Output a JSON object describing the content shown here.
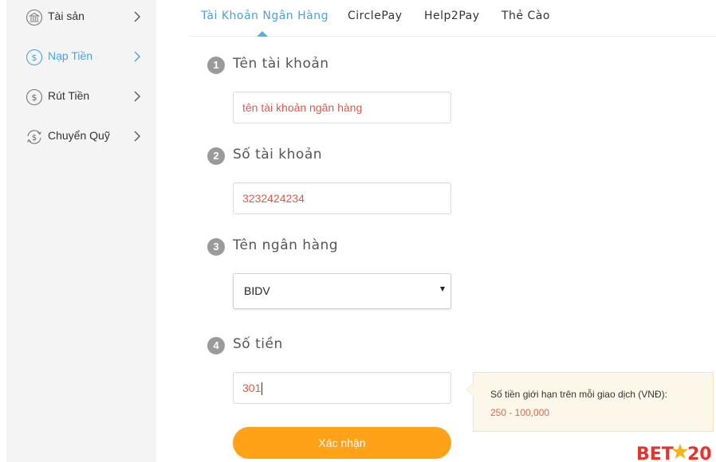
{
  "sidebar": {
    "items": [
      {
        "label": "Tài sản",
        "icon": "bank-icon"
      },
      {
        "label": "Nạp Tiền",
        "icon": "deposit-icon",
        "active": true
      },
      {
        "label": "Rút Tiền",
        "icon": "withdraw-icon"
      },
      {
        "label": "Chuyển Quỹ",
        "icon": "transfer-icon"
      }
    ]
  },
  "tabs": [
    {
      "label": "Tài Khoản Ngân Hàng",
      "active": true
    },
    {
      "label": "CirclePay"
    },
    {
      "label": "Help2Pay"
    },
    {
      "label": "Thẻ Cào"
    }
  ],
  "form": {
    "steps": [
      {
        "number": "1",
        "label": "Tên tài khoản"
      },
      {
        "number": "2",
        "label": "Số tài khoản"
      },
      {
        "number": "3",
        "label": "Tên ngân hàng"
      },
      {
        "number": "4",
        "label": "Số tiền"
      }
    ],
    "account_name_value": "tên tài khoản ngân hàng",
    "account_number_value": "3232424234",
    "bank_selected": "BIDV",
    "amount_value": "301",
    "submit_label": "Xác nhận"
  },
  "hint": {
    "text": "Số tiền giới hạn trên mỗi giao dịch (VNĐ):",
    "range": "250 - 100,000"
  },
  "logo": {
    "text_left": "BET",
    "text_right": "20"
  },
  "colors": {
    "accent": "#4aa3df",
    "button": "#ffa217",
    "input_text": "#e0574a",
    "hint_bg": "#fdf7ea",
    "logo_red": "#e8322c",
    "logo_star": "#f5b417"
  }
}
